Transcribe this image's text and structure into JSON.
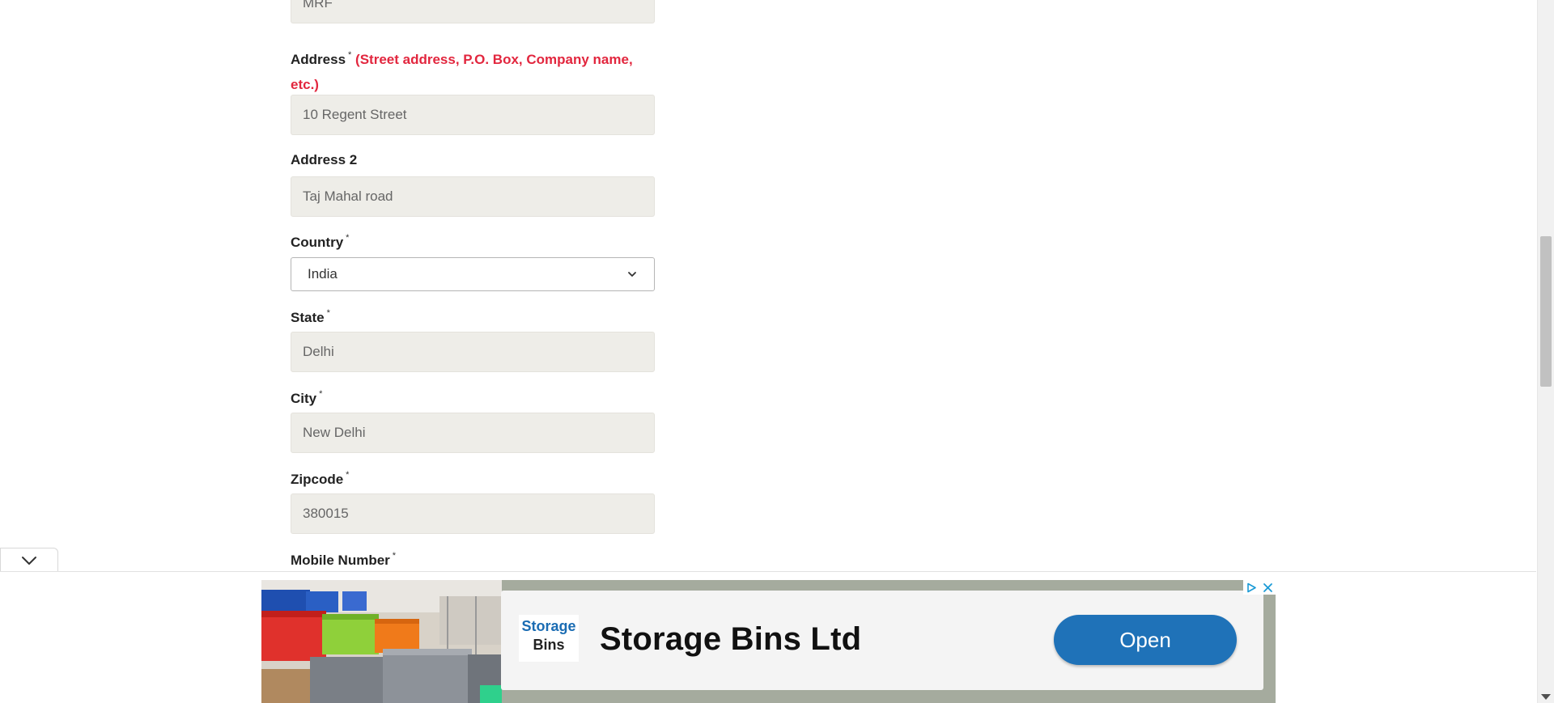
{
  "form": {
    "company_value": "MRF",
    "address": {
      "label": "Address",
      "required_mark": "*",
      "hint_line1": "(Street address, P.O. Box, Company name,",
      "hint_line2": "etc.)",
      "value": "10 Regent Street"
    },
    "address2": {
      "label": "Address 2",
      "value": "Taj Mahal road"
    },
    "country": {
      "label": "Country",
      "required_mark": "*",
      "selected": "India"
    },
    "state": {
      "label": "State",
      "required_mark": "*",
      "value": "Delhi"
    },
    "city": {
      "label": "City",
      "required_mark": "*",
      "value": "New Delhi"
    },
    "zipcode": {
      "label": "Zipcode",
      "required_mark": "*",
      "value": "380015"
    },
    "mobile": {
      "label": "Mobile Number",
      "required_mark": "*"
    }
  },
  "ad": {
    "logo_line1": "Storage",
    "logo_line2": "Bins",
    "title": "Storage Bins Ltd",
    "cta": "Open",
    "accent_color": "#1f72b8"
  },
  "icons": {
    "collapse": "chevron-down-icon",
    "select_arrow": "chevron-down-icon",
    "ad_choices": "adchoices-icon",
    "ad_close": "close-icon"
  }
}
